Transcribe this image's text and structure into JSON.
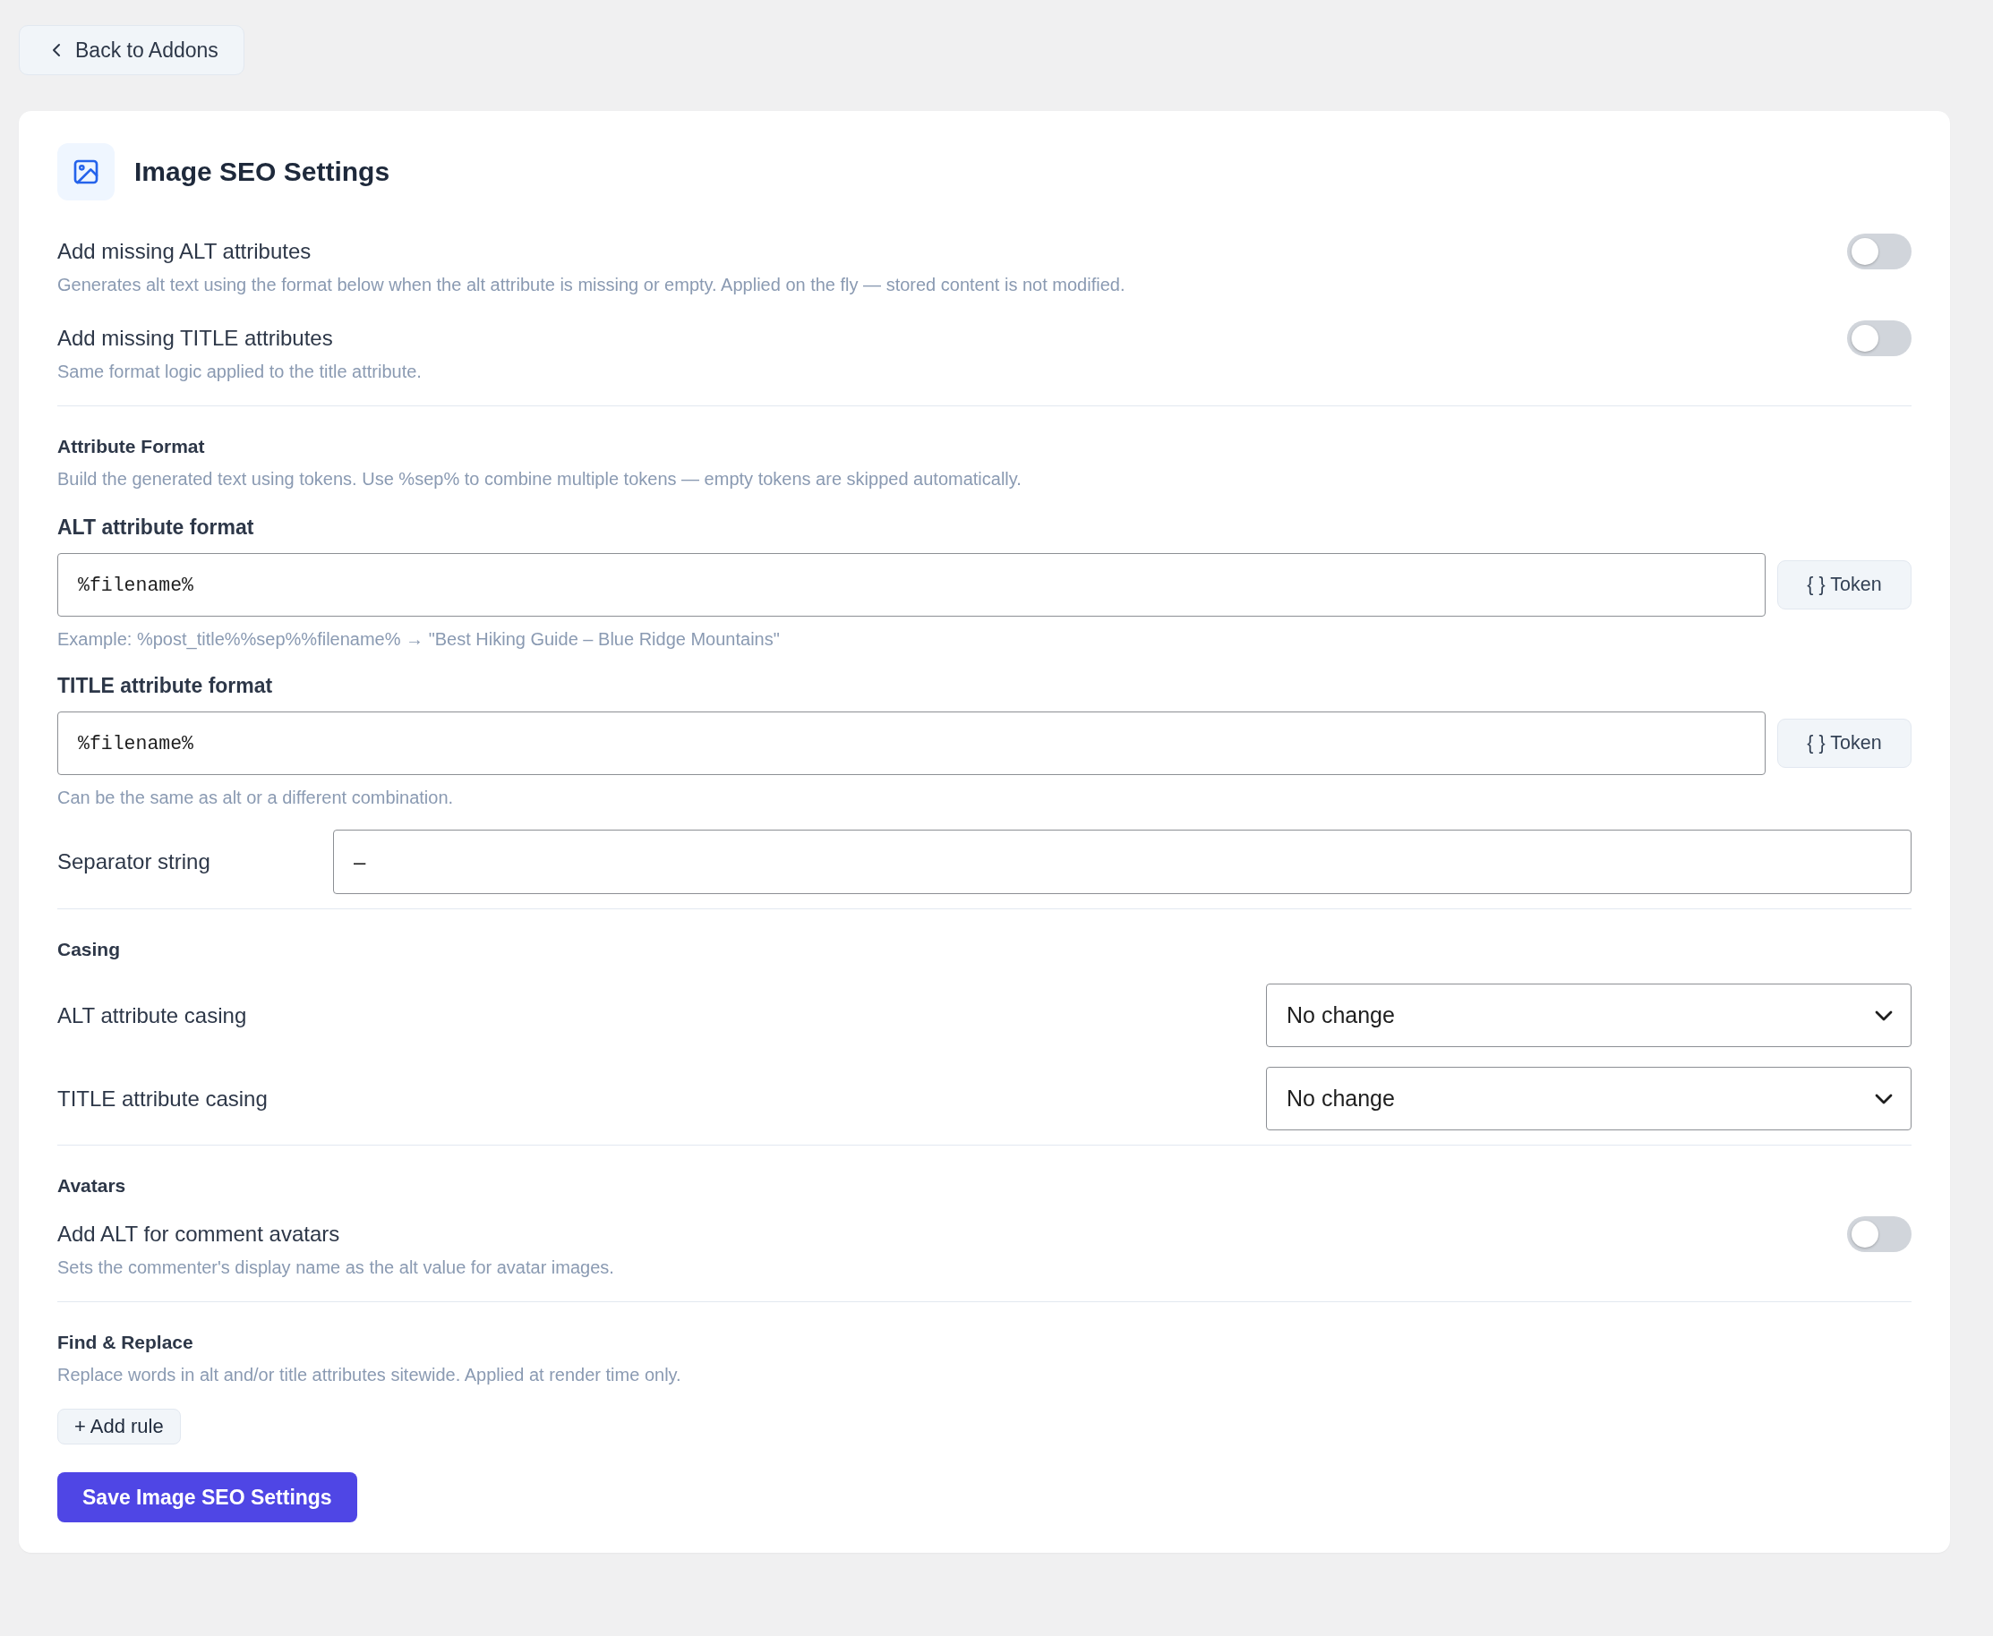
{
  "back_button": {
    "label": "Back to Addons"
  },
  "panel": {
    "title": "Image SEO Settings"
  },
  "sections": [
    {
      "items": [
        {
          "kind": "toggle",
          "label": "Add missing ALT attributes",
          "description": "Generates alt text using the format below when the alt attribute is missing or empty. Applied on the fly — stored content is not modified.",
          "on": false
        },
        {
          "kind": "toggle",
          "label": "Add missing TITLE attributes",
          "description": "Same format logic applied to the title attribute.",
          "on": false
        }
      ]
    },
    {
      "heading": "Attribute Format",
      "description": "Build the generated text using tokens. Use %sep% to combine multiple tokens — empty tokens are skipped automatically.",
      "items": [
        {
          "kind": "token_field",
          "label": "ALT attribute format",
          "value": "%filename%",
          "button": "{ } Token",
          "help": "Example: %post_title%%sep%%filename% → \"Best Hiking Guide – Blue Ridge Mountains\""
        },
        {
          "kind": "token_field",
          "label": "TITLE attribute format",
          "value": "%filename%",
          "button": "{ } Token",
          "help": "Can be the same as alt or a different combination."
        },
        {
          "kind": "inline_field",
          "label": "Separator string",
          "value": "–"
        }
      ]
    },
    {
      "heading": "Casing",
      "items": [
        {
          "kind": "select",
          "label": "ALT attribute casing",
          "value": "No change"
        },
        {
          "kind": "select",
          "label": "TITLE attribute casing",
          "value": "No change"
        }
      ]
    },
    {
      "heading": "Avatars",
      "items": [
        {
          "kind": "toggle",
          "label": "Add ALT for comment avatars",
          "description": "Sets the commenter's display name as the alt value for avatar images.",
          "on": false
        }
      ]
    },
    {
      "heading": "Find & Replace",
      "description": "Replace words in alt and/or title attributes sitewide. Applied at render time only.",
      "items": [
        {
          "kind": "button",
          "label": "+ Add rule"
        }
      ]
    }
  ],
  "save_button": {
    "label": "Save Image SEO Settings"
  }
}
